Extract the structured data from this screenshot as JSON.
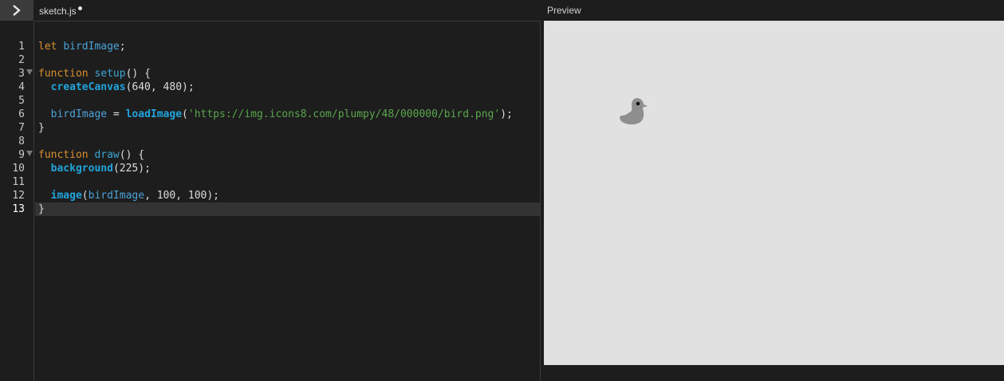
{
  "editor": {
    "file_tab": {
      "name": "sketch.js",
      "unsaved": true
    },
    "active_line": 13,
    "lines": [
      {
        "num": "1",
        "tokens": [
          {
            "t": "let",
            "c": "kw"
          },
          {
            "t": " ",
            "c": "pn"
          },
          {
            "t": "birdImage",
            "c": "var"
          },
          {
            "t": ";",
            "c": "pn"
          }
        ]
      },
      {
        "num": "2",
        "tokens": []
      },
      {
        "num": "3",
        "fold": true,
        "tokens": [
          {
            "t": "function",
            "c": "kw"
          },
          {
            "t": " ",
            "c": "pn"
          },
          {
            "t": "setup",
            "c": "fn"
          },
          {
            "t": "() {",
            "c": "pn"
          }
        ]
      },
      {
        "num": "4",
        "tokens": [
          {
            "t": "  ",
            "c": "pn"
          },
          {
            "t": "createCanvas",
            "c": "fnb"
          },
          {
            "t": "(640, 480);",
            "c": "pn"
          }
        ]
      },
      {
        "num": "5",
        "tokens": []
      },
      {
        "num": "6",
        "tokens": [
          {
            "t": "  ",
            "c": "pn"
          },
          {
            "t": "birdImage",
            "c": "var"
          },
          {
            "t": " = ",
            "c": "pn"
          },
          {
            "t": "loadImage",
            "c": "fnb"
          },
          {
            "t": "(",
            "c": "pn"
          },
          {
            "t": "'https://img.icons8.com/plumpy/48/000000/bird.png'",
            "c": "str"
          },
          {
            "t": ");",
            "c": "pn"
          }
        ]
      },
      {
        "num": "7",
        "tokens": [
          {
            "t": "}",
            "c": "pn"
          }
        ]
      },
      {
        "num": "8",
        "tokens": []
      },
      {
        "num": "9",
        "fold": true,
        "tokens": [
          {
            "t": "function",
            "c": "kw"
          },
          {
            "t": " ",
            "c": "pn"
          },
          {
            "t": "draw",
            "c": "fn"
          },
          {
            "t": "() {",
            "c": "pn"
          }
        ]
      },
      {
        "num": "10",
        "tokens": [
          {
            "t": "  ",
            "c": "pn"
          },
          {
            "t": "background",
            "c": "fnb"
          },
          {
            "t": "(225);",
            "c": "pn"
          }
        ]
      },
      {
        "num": "11",
        "tokens": []
      },
      {
        "num": "12",
        "tokens": [
          {
            "t": "  ",
            "c": "pn"
          },
          {
            "t": "image",
            "c": "fnb"
          },
          {
            "t": "(",
            "c": "pn"
          },
          {
            "t": "birdImage",
            "c": "var"
          },
          {
            "t": ", 100, 100);",
            "c": "pn"
          }
        ]
      },
      {
        "num": "13",
        "tokens": [
          {
            "t": "}",
            "c": "pn"
          }
        ]
      }
    ]
  },
  "preview": {
    "label": "Preview",
    "canvas_background": "#e1e1e1",
    "image_icon": "bird-icon"
  },
  "colors": {
    "keyword": "#d98e2f",
    "identifier": "#4aa3d8",
    "builtin_function": "#21a4db",
    "string": "#5aa64d",
    "app_background": "#1d1d1d"
  }
}
